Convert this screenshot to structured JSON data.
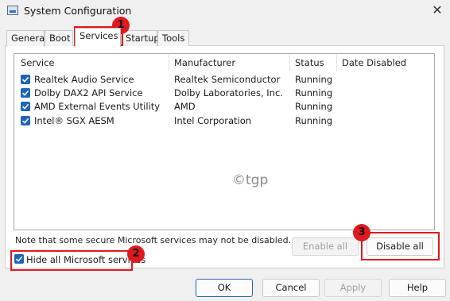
{
  "window": {
    "title": "System Configuration",
    "close_glyph": "✕"
  },
  "tabs": [
    "General",
    "Boot",
    "Services",
    "Startup",
    "Tools"
  ],
  "active_tab": "Services",
  "services": {
    "columns": [
      "Service",
      "Manufacturer",
      "Status",
      "Date Disabled"
    ],
    "rows": [
      {
        "checked": true,
        "service": "Realtek Audio Service",
        "manufacturer": "Realtek Semiconductor",
        "status": "Running",
        "date_disabled": ""
      },
      {
        "checked": true,
        "service": "Dolby DAX2 API Service",
        "manufacturer": "Dolby Laboratories, Inc.",
        "status": "Running",
        "date_disabled": ""
      },
      {
        "checked": true,
        "service": "AMD External Events Utility",
        "manufacturer": "AMD",
        "status": "Running",
        "date_disabled": ""
      },
      {
        "checked": true,
        "service": "Intel® SGX AESM",
        "manufacturer": "Intel Corporation",
        "status": "Running",
        "date_disabled": ""
      }
    ]
  },
  "watermark": "©tgp",
  "note": "Note that some secure Microsoft services may not be disabled.",
  "buttons": {
    "enable_all": "Enable all",
    "disable_all": "Disable all",
    "ok": "OK",
    "cancel": "Cancel",
    "apply": "Apply",
    "help": "Help"
  },
  "hide_ms": {
    "label": "Hide all Microsoft services",
    "checked": true
  },
  "annotations": [
    "1",
    "2",
    "3"
  ],
  "colors": {
    "accent": "#1e65b8",
    "annotation_red": "#e0191f"
  },
  "icons": {
    "app": "system-config-icon",
    "checkbox": "checkmark-icon"
  }
}
